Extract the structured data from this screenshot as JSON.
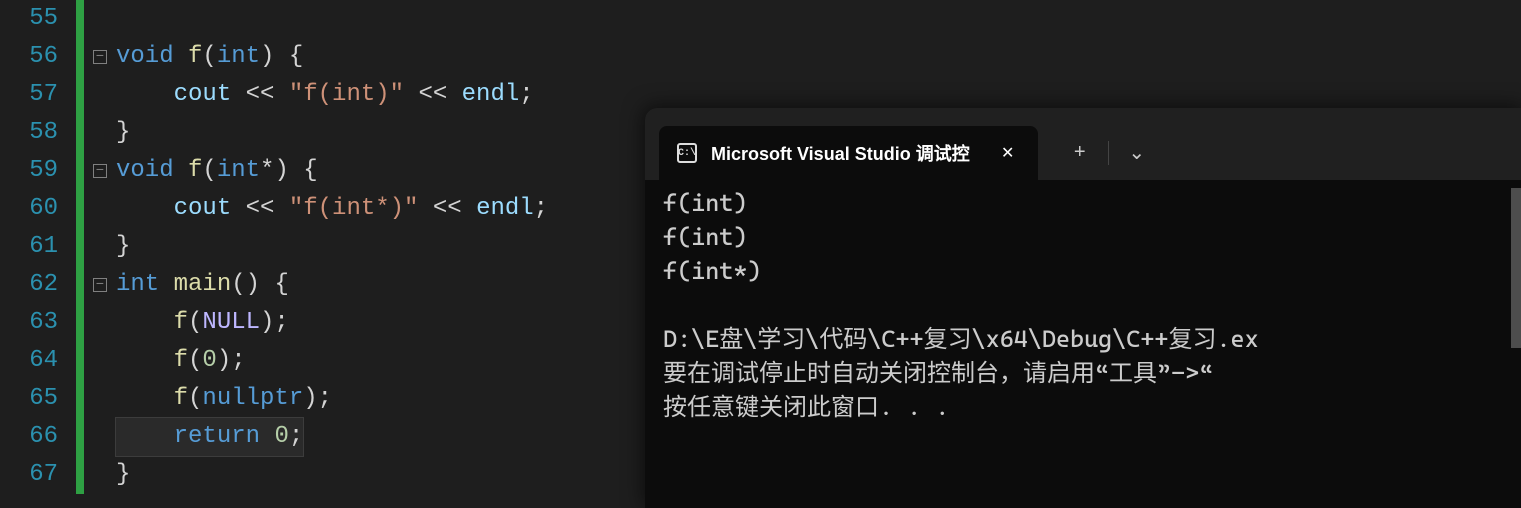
{
  "editor": {
    "lines": [
      {
        "num": "55",
        "fold": "none",
        "tokens": []
      },
      {
        "num": "56",
        "fold": "box",
        "tokens": [
          {
            "t": "void",
            "c": "kw"
          },
          {
            "t": " ",
            "c": "punct"
          },
          {
            "t": "f",
            "c": "ident"
          },
          {
            "t": "(",
            "c": "punct"
          },
          {
            "t": "int",
            "c": "type"
          },
          {
            "t": ") {",
            "c": "punct"
          }
        ]
      },
      {
        "num": "57",
        "fold": "line",
        "indent": "    ",
        "tokens": [
          {
            "t": "cout",
            "c": "obj"
          },
          {
            "t": " << ",
            "c": "punct"
          },
          {
            "t": "\"f(int)\"",
            "c": "str"
          },
          {
            "t": " << ",
            "c": "punct"
          },
          {
            "t": "endl",
            "c": "obj"
          },
          {
            "t": ";",
            "c": "punct"
          }
        ]
      },
      {
        "num": "58",
        "fold": "line",
        "tokens": [
          {
            "t": "}",
            "c": "punct"
          }
        ]
      },
      {
        "num": "59",
        "fold": "box",
        "tokens": [
          {
            "t": "void",
            "c": "kw"
          },
          {
            "t": " ",
            "c": "punct"
          },
          {
            "t": "f",
            "c": "ident"
          },
          {
            "t": "(",
            "c": "punct"
          },
          {
            "t": "int",
            "c": "type"
          },
          {
            "t": "*) {",
            "c": "punct"
          }
        ]
      },
      {
        "num": "60",
        "fold": "line",
        "indent": "    ",
        "tokens": [
          {
            "t": "cout",
            "c": "obj"
          },
          {
            "t": " << ",
            "c": "punct"
          },
          {
            "t": "\"f(int*)\"",
            "c": "str"
          },
          {
            "t": " << ",
            "c": "punct"
          },
          {
            "t": "endl",
            "c": "obj"
          },
          {
            "t": ";",
            "c": "punct"
          }
        ]
      },
      {
        "num": "61",
        "fold": "line",
        "tokens": [
          {
            "t": "}",
            "c": "punct"
          }
        ]
      },
      {
        "num": "62",
        "fold": "box",
        "tokens": [
          {
            "t": "int",
            "c": "type"
          },
          {
            "t": " ",
            "c": "punct"
          },
          {
            "t": "main",
            "c": "ident"
          },
          {
            "t": "() {",
            "c": "punct"
          }
        ]
      },
      {
        "num": "63",
        "fold": "line",
        "indent": "    ",
        "tokens": [
          {
            "t": "f",
            "c": "ident"
          },
          {
            "t": "(",
            "c": "punct"
          },
          {
            "t": "NULL",
            "c": "macro"
          },
          {
            "t": ");",
            "c": "punct"
          }
        ]
      },
      {
        "num": "64",
        "fold": "line",
        "indent": "    ",
        "tokens": [
          {
            "t": "f",
            "c": "ident"
          },
          {
            "t": "(",
            "c": "punct"
          },
          {
            "t": "0",
            "c": "num"
          },
          {
            "t": ");",
            "c": "punct"
          }
        ]
      },
      {
        "num": "65",
        "fold": "line",
        "indent": "    ",
        "tokens": [
          {
            "t": "f",
            "c": "ident"
          },
          {
            "t": "(",
            "c": "punct"
          },
          {
            "t": "nullptr",
            "c": "nullptrkw"
          },
          {
            "t": ");",
            "c": "punct"
          }
        ]
      },
      {
        "num": "66",
        "fold": "line",
        "indent": "    ",
        "current": true,
        "tokens": [
          {
            "t": "return",
            "c": "kw"
          },
          {
            "t": " ",
            "c": "punct"
          },
          {
            "t": "0",
            "c": "num"
          },
          {
            "t": ";",
            "c": "punct"
          }
        ]
      },
      {
        "num": "67",
        "fold": "line",
        "tokens": [
          {
            "t": "}",
            "c": "punct"
          }
        ]
      }
    ],
    "foldMinus": "−"
  },
  "console": {
    "tabTitle": "Microsoft Visual Studio 调试控",
    "closeGlyph": "✕",
    "newTabGlyph": "+",
    "dropdownGlyph": "⌄",
    "output": [
      "f(int)",
      "f(int)",
      "f(int*)",
      "",
      "D:\\E盘\\学习\\代码\\C++复习\\x64\\Debug\\C++复习.ex",
      "要在调试停止时自动关闭控制台，请启用“工具”->“",
      "按任意键关闭此窗口. . ."
    ]
  }
}
